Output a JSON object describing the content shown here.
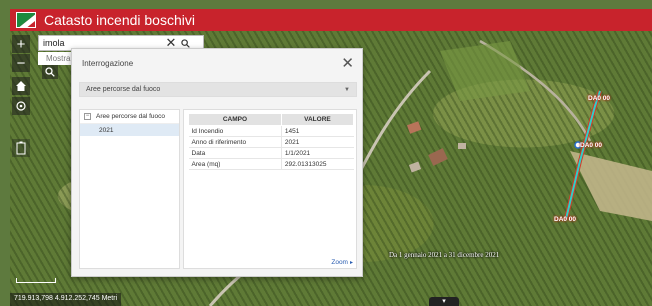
{
  "header": {
    "title": "Catasto incendi boschivi"
  },
  "search": {
    "value": "imola",
    "hint": "Mostra",
    "clear_icon": "✕"
  },
  "map_tools": [
    {
      "name": "zoom-in-button",
      "icon": "plus-icon"
    },
    {
      "name": "zoom-out-button",
      "icon": "minus-icon"
    },
    {
      "name": "home-button",
      "icon": "home-icon"
    },
    {
      "name": "locate-button",
      "icon": "locate-icon"
    }
  ],
  "popup": {
    "title": "Interrogazione",
    "close_icon": "✕",
    "layer_selected": "Aree percorse dal fuoco",
    "tree": {
      "group": "Aree percorse dal fuoco",
      "toggle": "−",
      "items": [
        "2021"
      ]
    },
    "table": {
      "headers": [
        "CAMPO",
        "VALORE"
      ],
      "rows": [
        {
          "campo": "Id Incendio",
          "valore": "1451"
        },
        {
          "campo": "Anno di riferimento",
          "valore": "2021"
        },
        {
          "campo": "Data",
          "valore": "1/1/2021"
        },
        {
          "campo": "Area (mq)",
          "valore": "292.01313025"
        }
      ]
    },
    "zoom_link": "Zoom"
  },
  "map": {
    "date_range_label": "Da 1 gennaio 2021 a 31 dicembre 2021",
    "feature_labels": [
      "DA0 00",
      "DA0 00",
      "DA0 00"
    ],
    "coordinates": "719.913,798  4.912.252,745 Metri",
    "feature_color": "#2fd0c8",
    "feature_outline_color": "#d23a2a"
  },
  "colors": {
    "header": "#c8232c",
    "selection": "#dfeaf5",
    "link": "#2a5db0"
  }
}
